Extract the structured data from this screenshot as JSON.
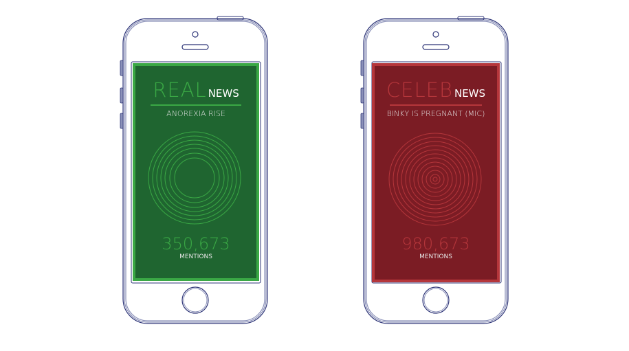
{
  "colors": {
    "outline": "#2d3477",
    "real_bg": "#1f6530",
    "real_accent": "#3aa845",
    "celeb_bg": "#7b1c24",
    "celeb_accent": "#b5363b"
  },
  "phones": [
    {
      "brand": "REAL",
      "suffix": "NEWS",
      "headline": "ANOREXIA RISE",
      "count": "350,673",
      "count_label": "MENTIONS"
    },
    {
      "brand": "CELEB",
      "suffix": "NEWS",
      "headline": "BINKY IS PREGNANT (MIC)",
      "count": "980,673",
      "count_label": "MENTIONS"
    }
  ]
}
